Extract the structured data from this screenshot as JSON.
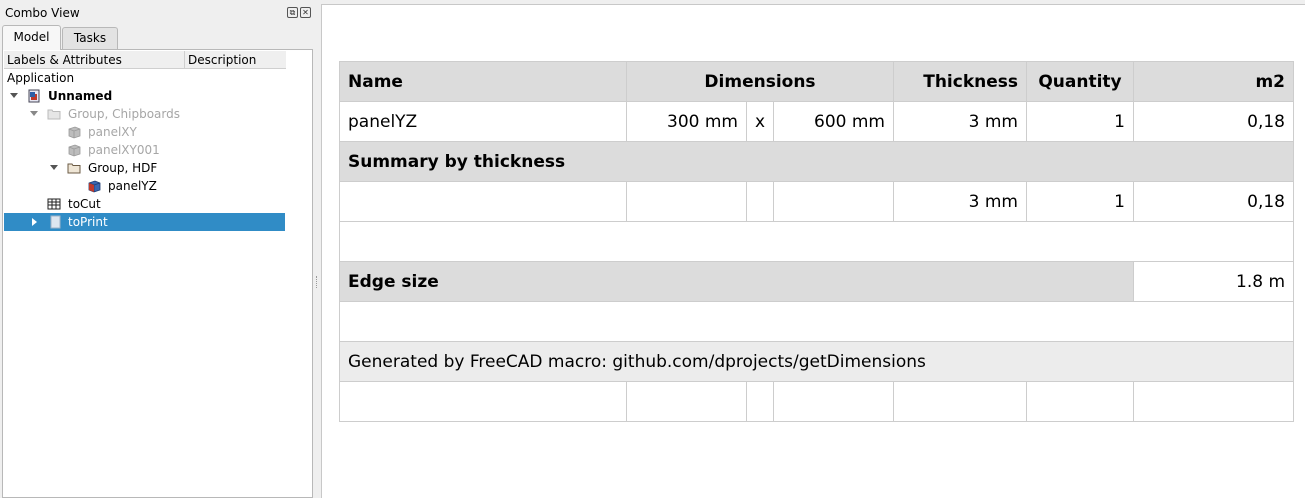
{
  "combo": {
    "title": "Combo View",
    "float_glyph": "⧉",
    "close_glyph": "✕",
    "tabs": [
      {
        "label": "Model",
        "active": true
      },
      {
        "label": "Tasks",
        "active": false
      }
    ],
    "columns": [
      "Labels & Attributes",
      "Description"
    ],
    "tree": {
      "root_label": "Application",
      "items": [
        {
          "label": "Unnamed",
          "icon": "document-icon",
          "bold": true
        },
        {
          "label": "Group, Chipboards",
          "icon": "folder-icon",
          "faded": true
        },
        {
          "label": "panelXY",
          "icon": "part-icon",
          "faded": true
        },
        {
          "label": "panelXY001",
          "icon": "part-icon",
          "faded": true
        },
        {
          "label": "Group, HDF",
          "icon": "folder-icon"
        },
        {
          "label": "panelYZ",
          "icon": "part-icon"
        },
        {
          "label": "toCut",
          "icon": "spreadsheet-icon"
        },
        {
          "label": "toPrint",
          "icon": "page-icon",
          "selected": true
        }
      ]
    }
  },
  "sheet": {
    "header": {
      "name": "Name",
      "dimensions": "Dimensions",
      "thickness": "Thickness",
      "quantity": "Quantity",
      "area": "m2"
    },
    "row1": {
      "name": "panelYZ",
      "width": "300 mm",
      "x": "x",
      "height": "600 mm",
      "thickness": "3 mm",
      "quantity": "1",
      "area": "0,18"
    },
    "summary_title": "Summary by thickness",
    "summary_row": {
      "thickness": "3 mm",
      "quantity": "1",
      "area": "0,18"
    },
    "edge": {
      "label": "Edge size",
      "value": "1.8 m"
    },
    "footer": "Generated by FreeCAD macro: github.com/dprojects/getDimensions"
  },
  "colors": {
    "selection": "#308cc6",
    "header_bg": "#dcdcdc",
    "footer_bg": "#ececec"
  }
}
